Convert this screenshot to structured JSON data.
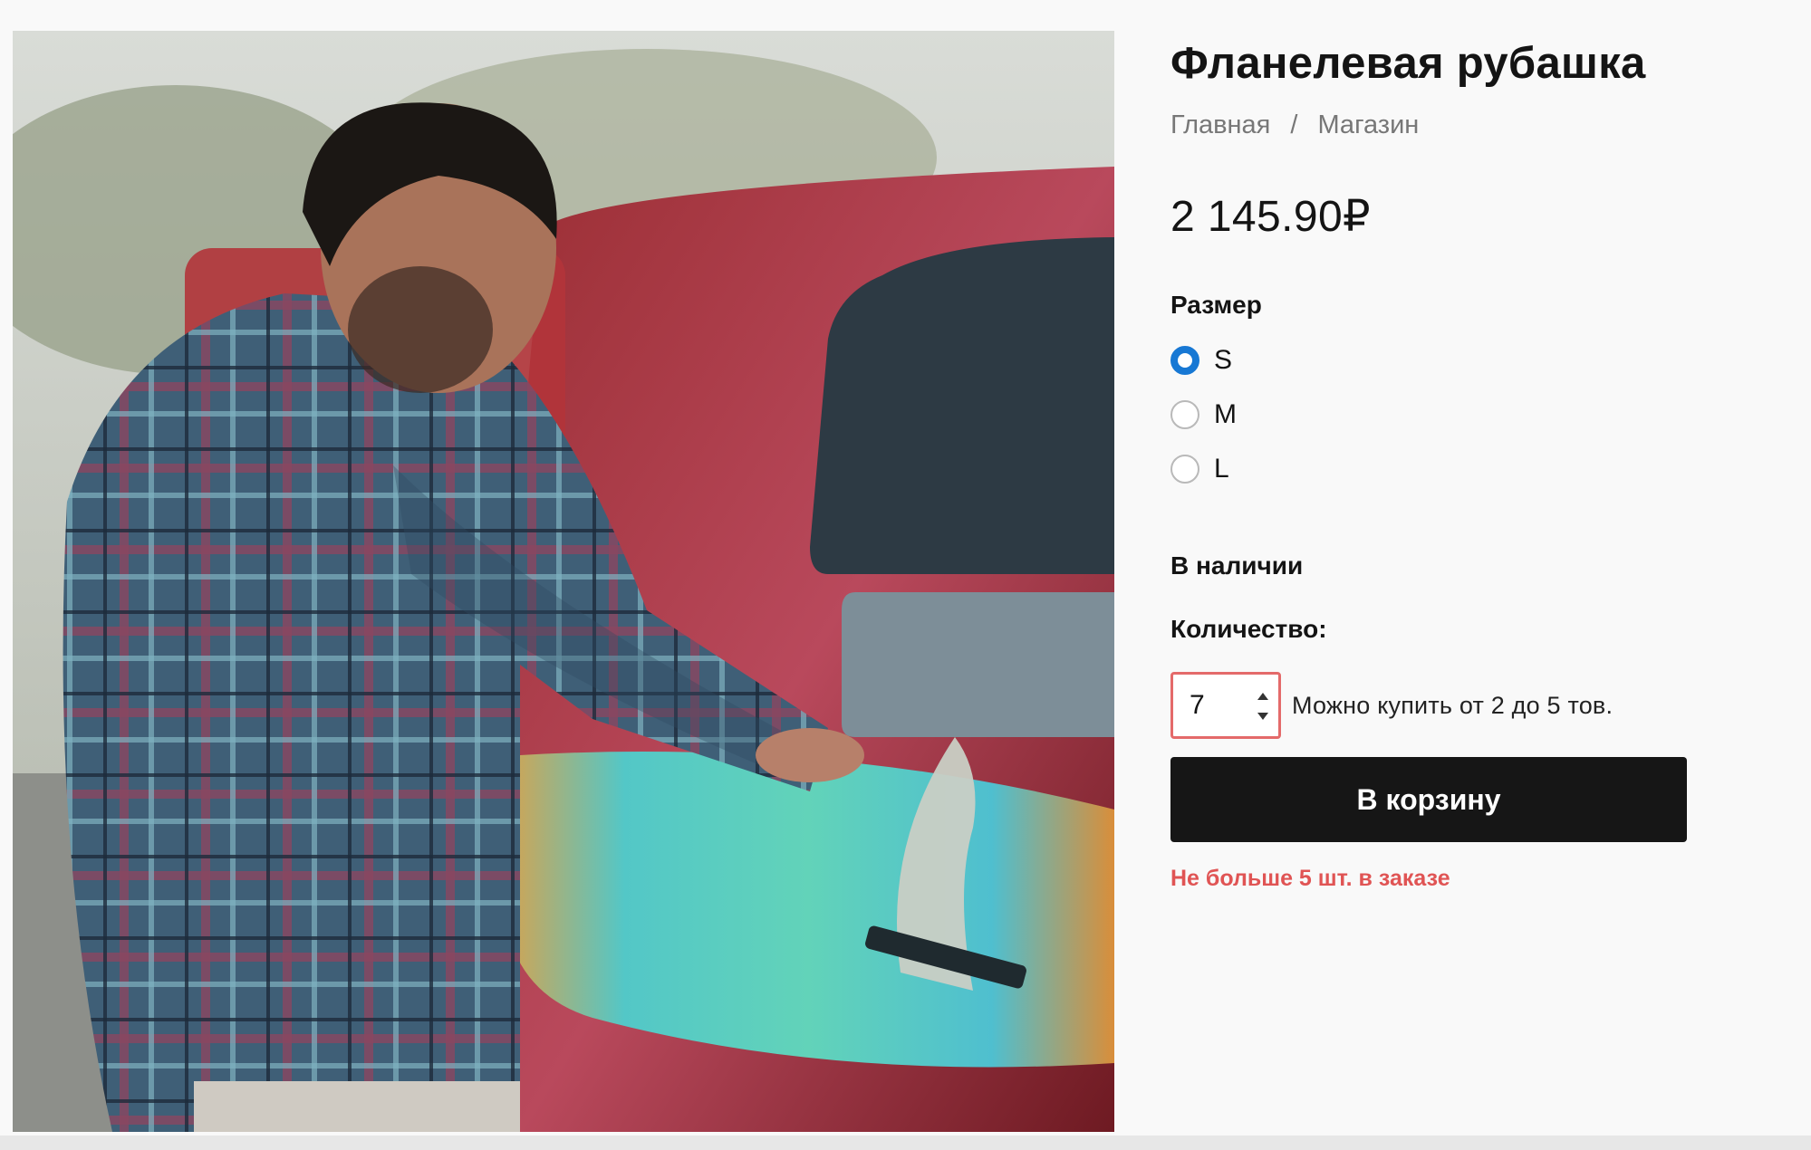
{
  "product": {
    "title": "Фланелевая рубашка",
    "image_alt": "product-photo-man-flannel-shirt-surfboard-van",
    "price": "2 145.90₽"
  },
  "breadcrumb": {
    "home": "Главная",
    "separator": "/",
    "shop": "Магазин"
  },
  "size": {
    "label": "Размер",
    "selected": "S",
    "options": [
      {
        "value": "S",
        "checked": true
      },
      {
        "value": "M",
        "checked": false
      },
      {
        "value": "L",
        "checked": false
      }
    ]
  },
  "stock": {
    "status": "В наличии"
  },
  "quantity": {
    "label": "Количество:",
    "value": "7",
    "hint": "Можно купить от 2 до 5 тов."
  },
  "cart": {
    "button_label": "В корзину"
  },
  "error": {
    "message": "Не больше 5 шт. в заказе"
  },
  "colors": {
    "accent_radio": "#1778d4",
    "error": "#e05454",
    "button_bg": "#161616",
    "button_text": "#ffffff"
  },
  "icons": {
    "stepper_up": "caret-up-icon",
    "stepper_down": "caret-down-icon"
  }
}
